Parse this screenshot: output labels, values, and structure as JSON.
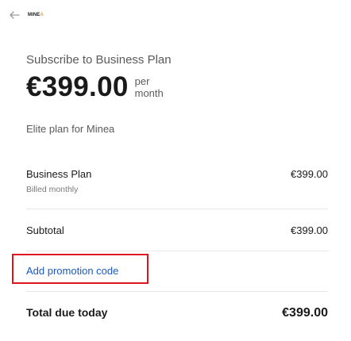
{
  "header": {
    "logo_main": "MINE",
    "logo_accent": "A"
  },
  "summary": {
    "title": "Subscribe to Business Plan",
    "price": "€399.00",
    "period_line1": "per",
    "period_line2": "month",
    "description": "Elite plan for Minea"
  },
  "line_items": [
    {
      "name": "Business Plan",
      "billing": "Billed monthly",
      "amount": "€399.00"
    }
  ],
  "subtotal": {
    "label": "Subtotal",
    "amount": "€399.00"
  },
  "promo": {
    "label": "Add promotion code",
    "highlight_color": "#e0141e"
  },
  "total": {
    "label": "Total due today",
    "amount": "€399.00"
  }
}
